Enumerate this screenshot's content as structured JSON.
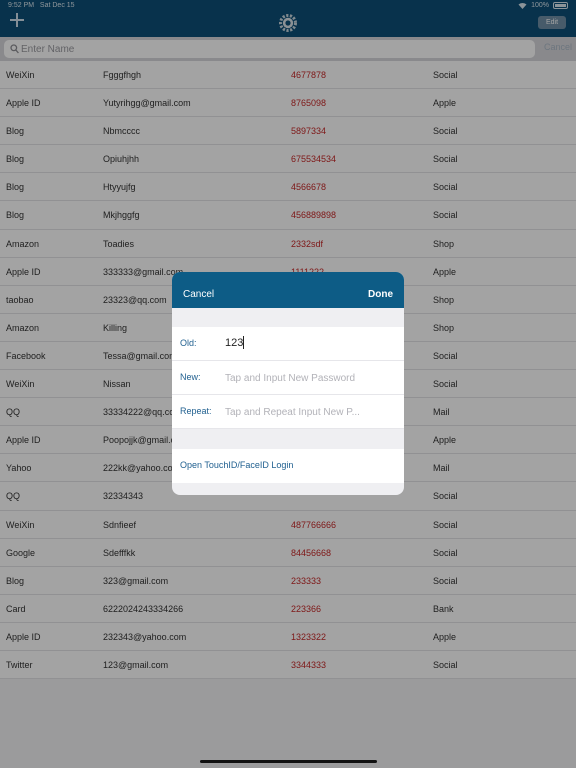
{
  "status": {
    "time": "9:52 PM",
    "date": "Sat Dec 15",
    "battery": "100%"
  },
  "toolbar": {
    "edit_label": "Edit"
  },
  "search": {
    "placeholder": "Enter Name",
    "cancel_label": "Cancel"
  },
  "rows": [
    [
      "WeiXin",
      "Fgggfhgh",
      "4677878",
      "Social"
    ],
    [
      "Apple ID",
      "Yutyrihgg@gmail.com",
      "8765098",
      "Apple"
    ],
    [
      "Blog",
      "Nbmcccc",
      "5897334",
      "Social"
    ],
    [
      "Blog",
      "Opiuhjhh",
      "675534534",
      "Social"
    ],
    [
      "Blog",
      "Htyyujfg",
      "4566678",
      "Social"
    ],
    [
      "Blog",
      "Mkjhggfg",
      "456889898",
      "Social"
    ],
    [
      "Amazon",
      "Toadies",
      "2332sdf",
      "Shop"
    ],
    [
      "Apple ID",
      "333333@gmail.com",
      "1111222",
      "Apple"
    ],
    [
      "taobao",
      "23323@qq.com",
      "",
      "Shop"
    ],
    [
      "Amazon",
      "Killing",
      "",
      "Shop"
    ],
    [
      "Facebook",
      "Tessa@gmail.com",
      "",
      "Social"
    ],
    [
      "WeiXin",
      "Nissan",
      "",
      "Social"
    ],
    [
      "QQ",
      "33334222@qq.com",
      "",
      "Mail"
    ],
    [
      "Apple ID",
      "Poopojjk@gmail.com",
      "",
      "Apple"
    ],
    [
      "Yahoo",
      "222kk@yahoo.com",
      "",
      "Mail"
    ],
    [
      "QQ",
      "32334343",
      "",
      "Social"
    ],
    [
      "WeiXin",
      "Sdnfieef",
      "487766666",
      "Social"
    ],
    [
      "Google",
      "Sdefffkk",
      "84456668",
      "Social"
    ],
    [
      "Blog",
      "323@gmail.com",
      "233333",
      "Social"
    ],
    [
      "Card",
      "6222024243334266",
      "223366",
      "Bank"
    ],
    [
      "Apple ID",
      "232343@yahoo.com",
      "1323322",
      "Apple"
    ],
    [
      "Twitter",
      "123@gmail.com",
      "3344333",
      "Social"
    ]
  ],
  "dialog": {
    "cancel_label": "Cancel",
    "done_label": "Done",
    "old_label": "Old:",
    "old_value": "123",
    "new_label": "New:",
    "new_placeholder": "Tap and Input New Password",
    "repeat_label": "Repeat:",
    "repeat_placeholder": "Tap and Repeat Input New P...",
    "touch_label": "Open TouchID/FaceID Login"
  },
  "colors": {
    "header": "#0d4f77",
    "dialog_header": "#0d5c86",
    "password": "#c62828",
    "link": "#1f5f8f"
  }
}
